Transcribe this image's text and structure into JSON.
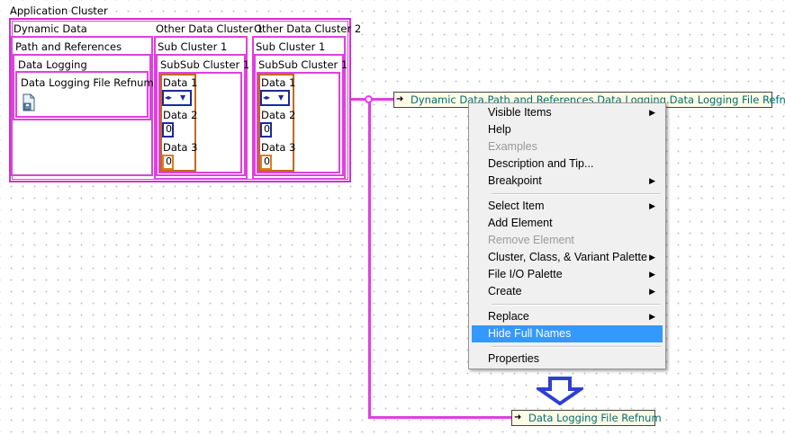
{
  "cluster": {
    "title": "Application Cluster",
    "dynamic_data": "Dynamic Data",
    "path_and_references": "Path and References",
    "data_logging": "Data Logging",
    "refnum_label": "Data Logging File Refnum",
    "other_1": "Other Data Cluster 1",
    "other_2": "Other Data Cluster 2",
    "sub_cluster": "Sub Cluster 1",
    "subsub_cluster": "SubSub Cluster 1",
    "data1": "Data 1",
    "data2": "Data 2",
    "data3": "Data 3",
    "data2_value": "0",
    "data3_value": "0"
  },
  "probe_top": {
    "label": "Dynamic Data.Path and References.Data Logging.Data Logging File Refnum"
  },
  "probe_bottom": {
    "label": "Data Logging File Refnum"
  },
  "context_menu": {
    "visible_items": "Visible Items",
    "help": "Help",
    "examples": "Examples",
    "description": "Description and Tip...",
    "breakpoint": "Breakpoint",
    "select_item": "Select Item",
    "add_element": "Add Element",
    "remove_element": "Remove Element",
    "cluster_palette": "Cluster, Class, & Variant Palette",
    "file_io_palette": "File I/O Palette",
    "create": "Create",
    "replace": "Replace",
    "hide_full_names": "Hide Full Names",
    "properties": "Properties"
  },
  "colors": {
    "wire": "#e040e0",
    "highlight": "#3399ff",
    "probe_text": "#006d74",
    "down_arrow": "#2f3fd0"
  }
}
